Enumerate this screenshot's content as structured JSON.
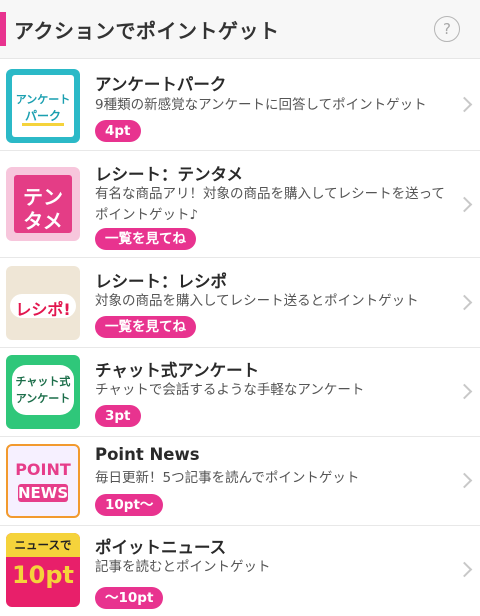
{
  "header": {
    "title": "アクションでポイントゲット",
    "help_glyph": "?"
  },
  "items": [
    {
      "name": "アンケートパーク",
      "desc": "9種類の新感覚なアンケートに回答してポイントゲット",
      "badge": "4pt",
      "thumb_text": [
        "アンケート",
        "パーク"
      ],
      "icon": "enquete-park-icon"
    },
    {
      "name": "レシート：テンタメ",
      "desc": "有名な商品アリ！対象の商品を購入してレシートを送ってポイントゲット♪",
      "badge": "一覧を見てね",
      "thumb_text": [
        "テン",
        "タメ"
      ],
      "icon": "tentame-icon"
    },
    {
      "name": "レシート：レシポ",
      "desc": "対象の商品を購入してレシート送るとポイントゲット",
      "badge": "一覧を見てね",
      "thumb_text": [
        "レシポ!"
      ],
      "icon": "reshipo-icon"
    },
    {
      "name": "チャット式アンケート",
      "desc": "チャットで会話するような手軽なアンケート",
      "badge": "3pt",
      "thumb_text": [
        "チャット式",
        "アンケート"
      ],
      "icon": "chat-enquete-icon"
    },
    {
      "name": "Point News",
      "desc": "毎日更新！5つ記事を読んでポイントゲット",
      "badge": "10pt〜",
      "thumb_text": [
        "POINT",
        "NEWS"
      ],
      "icon": "point-news-icon"
    },
    {
      "name": "ポイットニュース",
      "desc": "記事を読むとポイントゲット",
      "badge": "〜10pt",
      "thumb_text": [
        "ニュースで",
        "10pt"
      ],
      "icon": "poitto-news-icon"
    }
  ],
  "colors": {
    "accent": "#e8338f"
  }
}
